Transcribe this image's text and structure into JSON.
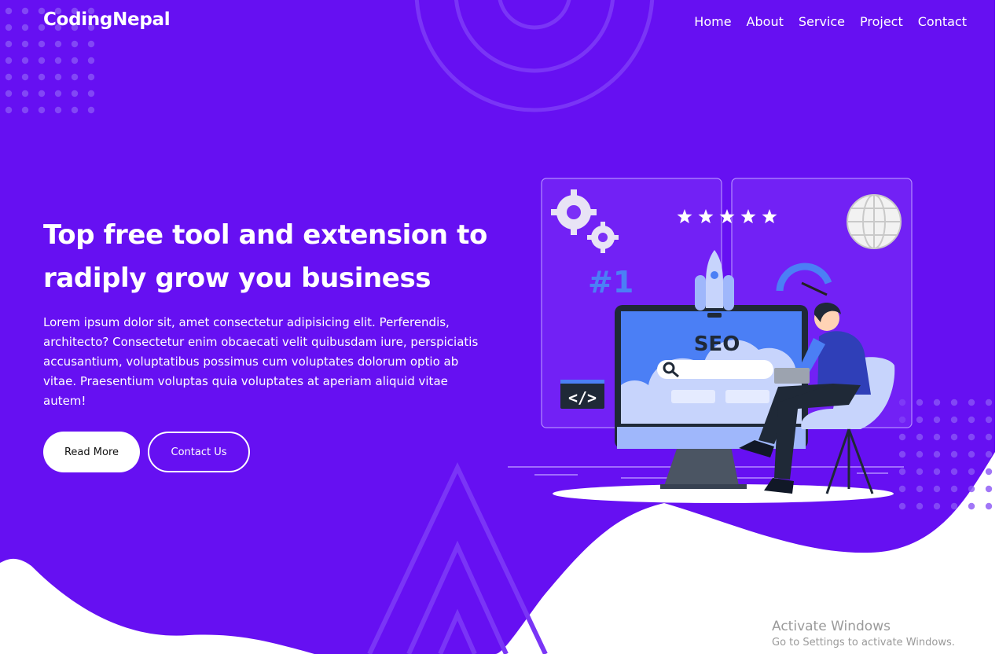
{
  "brand": {
    "logo": "CodingNepal"
  },
  "nav": {
    "items": [
      "Home",
      "About",
      "Service",
      "Project",
      "Contact"
    ]
  },
  "hero": {
    "title_line1": "Top free tool and extension to",
    "title_line2": "radiply grow you business",
    "description": "Lorem ipsum dolor sit, amet consectetur adipisicing elit. Perferendis, architecto? Consectetur enim obcaecati velit quibusdam iure, perspiciatis accusantium, voluptatibus possimus cum voluptates dolorum optio ab vitae. Praesentium voluptas quia voluptates at aperiam aliquid vitae autem!",
    "read_more": "Read More",
    "contact_us": "Contact Us"
  },
  "illustration": {
    "badge": "#1",
    "seo_label": "SEO",
    "code_label": "</>",
    "rating_stars": 5
  },
  "colors": {
    "primary": "#6610f2",
    "accent": "#8a4cf6",
    "white": "#ffffff"
  },
  "watermark": {
    "title": "Activate Windows",
    "subtitle": "Go to Settings to activate Windows."
  }
}
